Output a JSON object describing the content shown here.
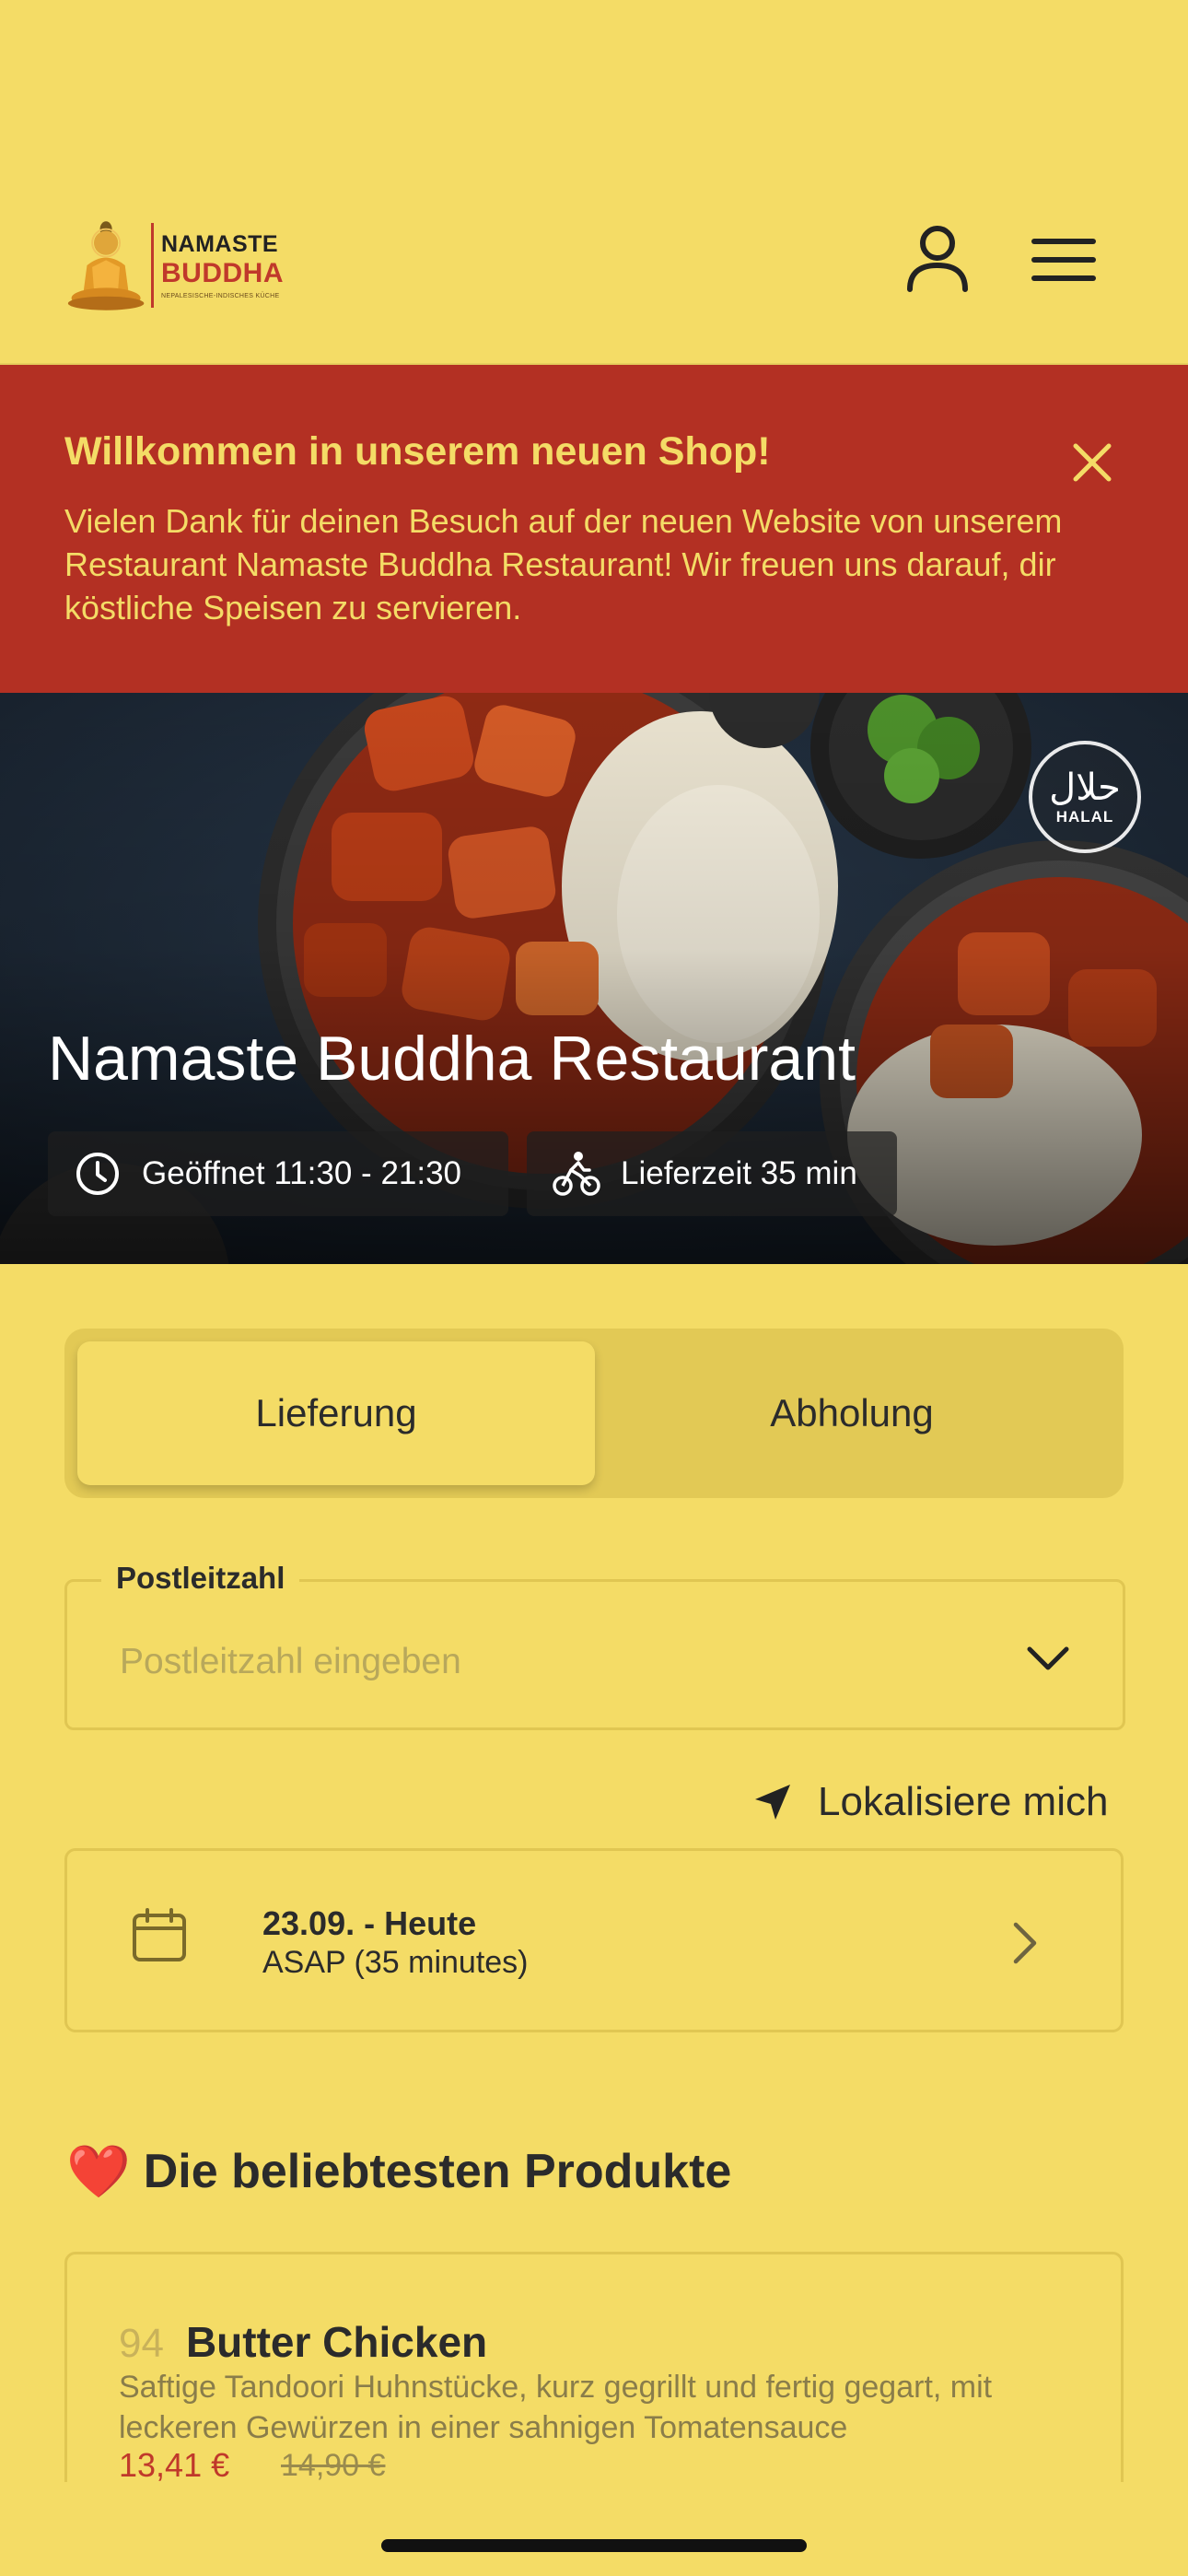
{
  "header": {
    "logo": {
      "line1": "NAMASTE",
      "line2": "BUDDHA",
      "line3": "NEPALESISCHE-INDISCHES KÜCHE"
    },
    "user_icon": "user-icon",
    "menu_icon": "hamburger-menu-icon"
  },
  "banner": {
    "title": "Willkommen in unserem neuen Shop!",
    "text": "Vielen Dank für deinen Besuch auf der neuen Website von unserem Restaurant Namaste Buddha Restaurant! Wir freuen uns darauf, dir köstliche Speisen zu servieren.",
    "close_icon": "close-icon",
    "background": "#b33023",
    "text_color": "#f4dc66"
  },
  "hero": {
    "title": "Namaste Buddha Restaurant",
    "badge_arabic": "حلال",
    "badge_label": "HALAL",
    "opening": "Geöffnet 11:30 - 21:30",
    "delivery_time": "Lieferzeit 35 min"
  },
  "order_mode": {
    "options": [
      "Lieferung",
      "Abholung"
    ],
    "selected": "Lieferung"
  },
  "postcode": {
    "label": "Postleitzahl",
    "placeholder": "Postleitzahl eingeben",
    "value": ""
  },
  "locate": {
    "label": "Lokalisiere mich",
    "icon": "location-arrow-icon"
  },
  "schedule": {
    "date": "23.09. - Heute",
    "time": "ASAP (35 minutes)",
    "icon": "calendar-icon"
  },
  "popular": {
    "heading": "Die beliebtesten Produkte",
    "heart": "❤️",
    "products": [
      {
        "number": "94",
        "name": "Butter Chicken",
        "description": "Saftige Tandoori Huhnstücke, kurz gegrillt und fertig gegart, mit leckeren Gewürzen in einer sahnigen Tomatensauce",
        "price": "13,41 €",
        "old_price": "14,90 €"
      }
    ]
  },
  "colors": {
    "background": "#f4dc66",
    "accent_red": "#c0392b",
    "text": "#2b2b2b"
  }
}
